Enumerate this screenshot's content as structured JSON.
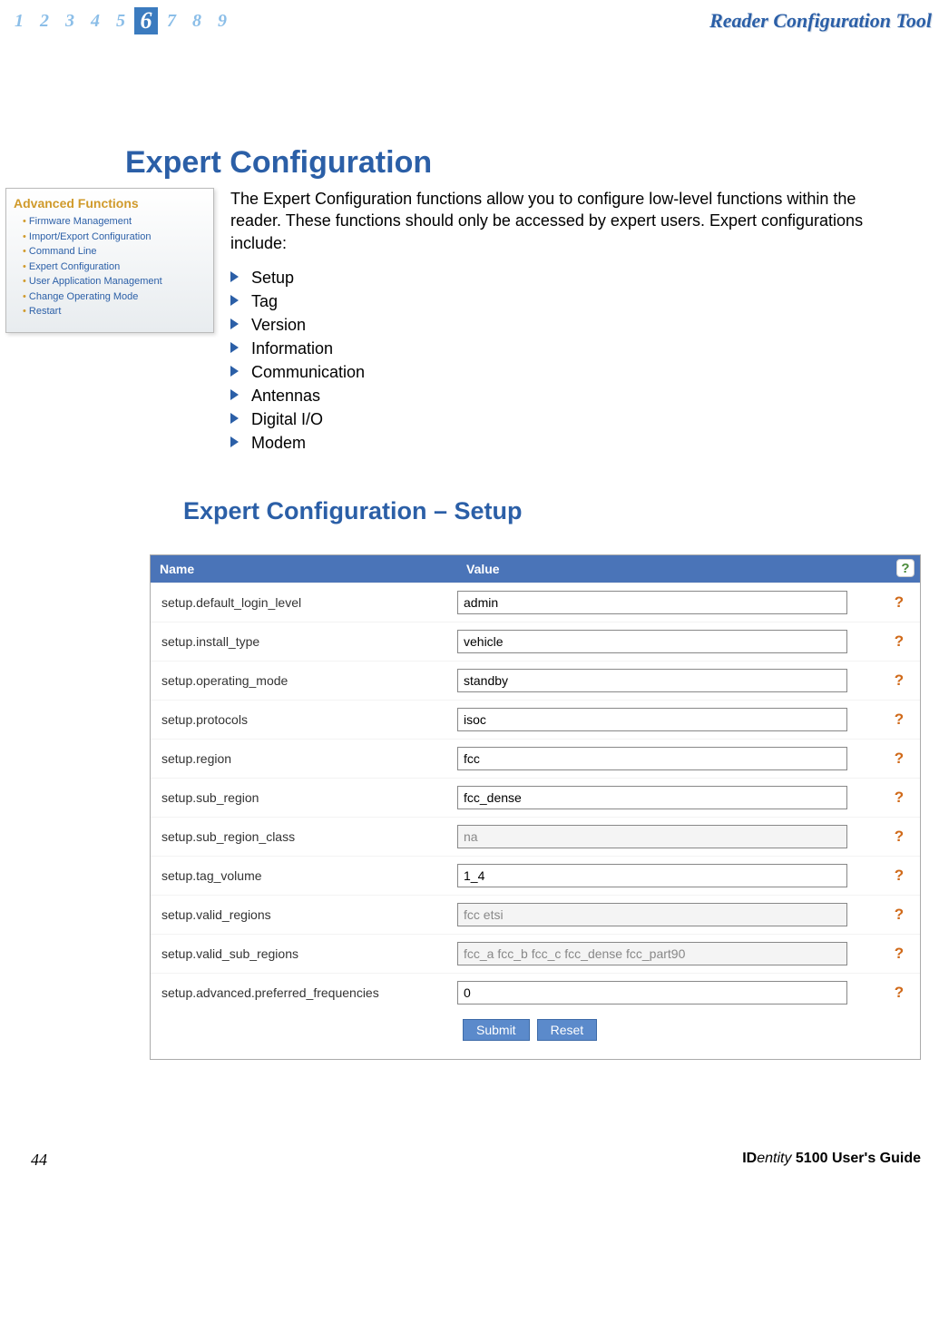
{
  "header": {
    "page_numbers": [
      "1",
      "2",
      "3",
      "4",
      "5",
      "6",
      "7",
      "8",
      "9"
    ],
    "active_index": 5,
    "tool_title": "Reader Configuration Tool"
  },
  "main_heading": "Expert Configuration",
  "panel": {
    "title": "Advanced Functions",
    "items": [
      "Firmware Management",
      "Import/Export Configuration",
      "Command Line",
      "Expert Configuration",
      "User Application Management",
      "Change Operating Mode",
      "Restart"
    ]
  },
  "intro_text": "The Expert Configuration functions allow you to configure low-level functions within the reader. These functions should only be accessed by expert users. Expert configurations include:",
  "features": [
    "Setup",
    "Tag",
    "Version",
    "Information",
    "Communication",
    "Antennas",
    "Digital I/O",
    "Modem"
  ],
  "sub_heading": "Expert Configuration – Setup",
  "table": {
    "header_name": "Name",
    "header_value": "Value",
    "help_label": "?",
    "rows": [
      {
        "name": "setup.default_login_level",
        "value": "admin",
        "disabled": false
      },
      {
        "name": "setup.install_type",
        "value": "vehicle",
        "disabled": false
      },
      {
        "name": "setup.operating_mode",
        "value": "standby",
        "disabled": false
      },
      {
        "name": "setup.protocols",
        "value": "isoc",
        "disabled": false
      },
      {
        "name": "setup.region",
        "value": "fcc",
        "disabled": false
      },
      {
        "name": "setup.sub_region",
        "value": "fcc_dense",
        "disabled": false
      },
      {
        "name": "setup.sub_region_class",
        "value": "na",
        "disabled": true
      },
      {
        "name": "setup.tag_volume",
        "value": "1_4",
        "disabled": false
      },
      {
        "name": "setup.valid_regions",
        "value": "fcc etsi",
        "disabled": true
      },
      {
        "name": "setup.valid_sub_regions",
        "value": "fcc_a fcc_b fcc_c fcc_dense fcc_part90",
        "disabled": true
      },
      {
        "name": "setup.advanced.preferred_frequencies",
        "value": "0",
        "disabled": false
      }
    ],
    "submit_label": "Submit",
    "reset_label": "Reset"
  },
  "footer": {
    "page_number": "44",
    "guide_prefix": "ID",
    "guide_mid": "entity",
    "guide_suffix": " 5100 User's Guide"
  }
}
